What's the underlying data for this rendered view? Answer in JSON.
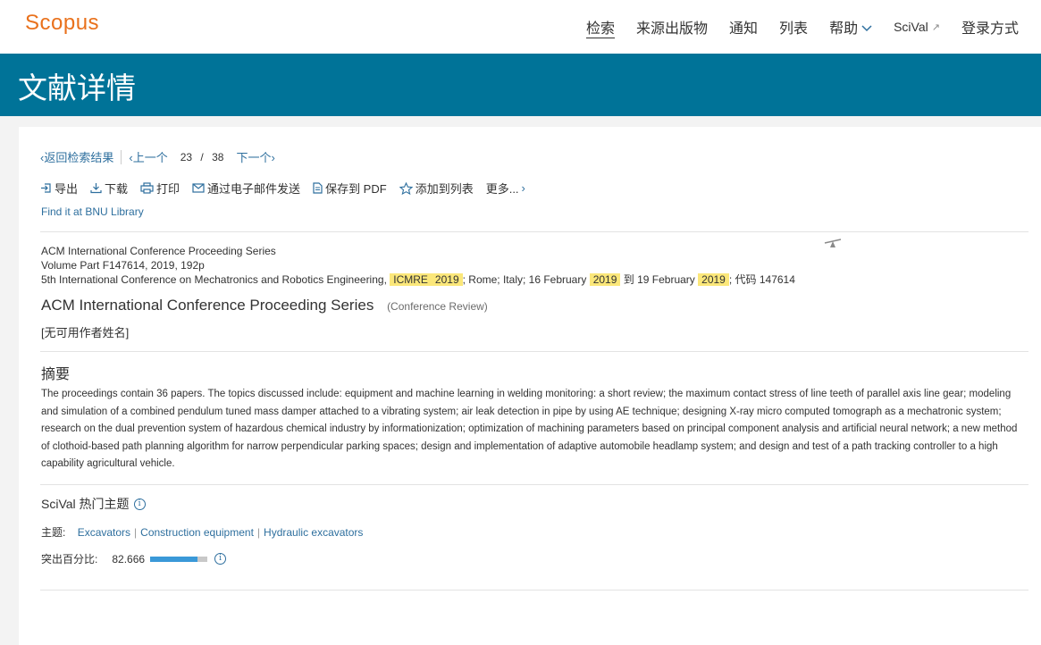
{
  "header": {
    "logo": "Scopus",
    "nav": [
      {
        "label": "检索",
        "active": true
      },
      {
        "label": "来源出版物"
      },
      {
        "label": "通知"
      },
      {
        "label": "列表"
      },
      {
        "label": "帮助"
      },
      {
        "label": "SciVal"
      },
      {
        "label": "登录方式"
      }
    ]
  },
  "banner": {
    "title": "文献详情"
  },
  "results_nav": {
    "back": "返回检索结果",
    "prev": "上一个",
    "current": "23",
    "separator": "/",
    "total": "38",
    "next": "下一个"
  },
  "actions": {
    "export": "导出",
    "download": "下载",
    "print": "打印",
    "email": "通过电子邮件发送",
    "save_pdf": "保存到 PDF",
    "add_list": "添加到列表",
    "more": "更多..."
  },
  "library_link": "Find it at BNU Library",
  "source": {
    "line1": "ACM International Conference Proceeding Series",
    "line2": "Volume Part F147614, 2019, 192p",
    "line3_pre": "5th International Conference on Mechatronics and Robotics Engineering,",
    "hl1": "ICMRE",
    "hl2": "2019",
    "line3_mid1": "; Rome; Italy; 16 February",
    "hl3": "2019",
    "line3_mid2": "到 19 February",
    "hl4": "2019",
    "line3_end": "; 代码 147614"
  },
  "document": {
    "title": "ACM International Conference Proceeding Series",
    "type": "(Conference Review)",
    "authors": "[无可用作者姓名]"
  },
  "abstract": {
    "heading": "摘要",
    "text": "The proceedings contain 36 papers. The topics discussed include: equipment and machine learning in welding monitoring: a short review; the maximum contact stress of line teeth of parallel axis line gear; modeling and simulation of a combined pendulum tuned mass damper attached to a vibrating system; air leak detection in pipe by using AE technique; designing X-ray micro computed tomograph as a mechatronic system; research on the dual prevention system of hazardous chemical industry by informationization; optimization of machining parameters based on principal component analysis and artificial neural network; a new method of clothoid-based path planning algorithm for narrow perpendicular parking spaces; design and implementation of adaptive automobile headlamp system; and design and test of a path tracking controller to a high capability agricultural vehicle."
  },
  "scival": {
    "heading": "SciVal 热门主题",
    "topics_label": "主题:",
    "topics": [
      "Excavators",
      "Construction equipment",
      "Hydraulic excavators"
    ],
    "prominence_label": "突出百分比:",
    "prominence_value": "82.666",
    "prominence_fraction": 0.83
  },
  "colors": {
    "accent": "#e9711c",
    "banner": "#007398",
    "link": "#2e6f9e",
    "highlight": "#fbe77a",
    "bar_fill": "#3a99d8"
  }
}
